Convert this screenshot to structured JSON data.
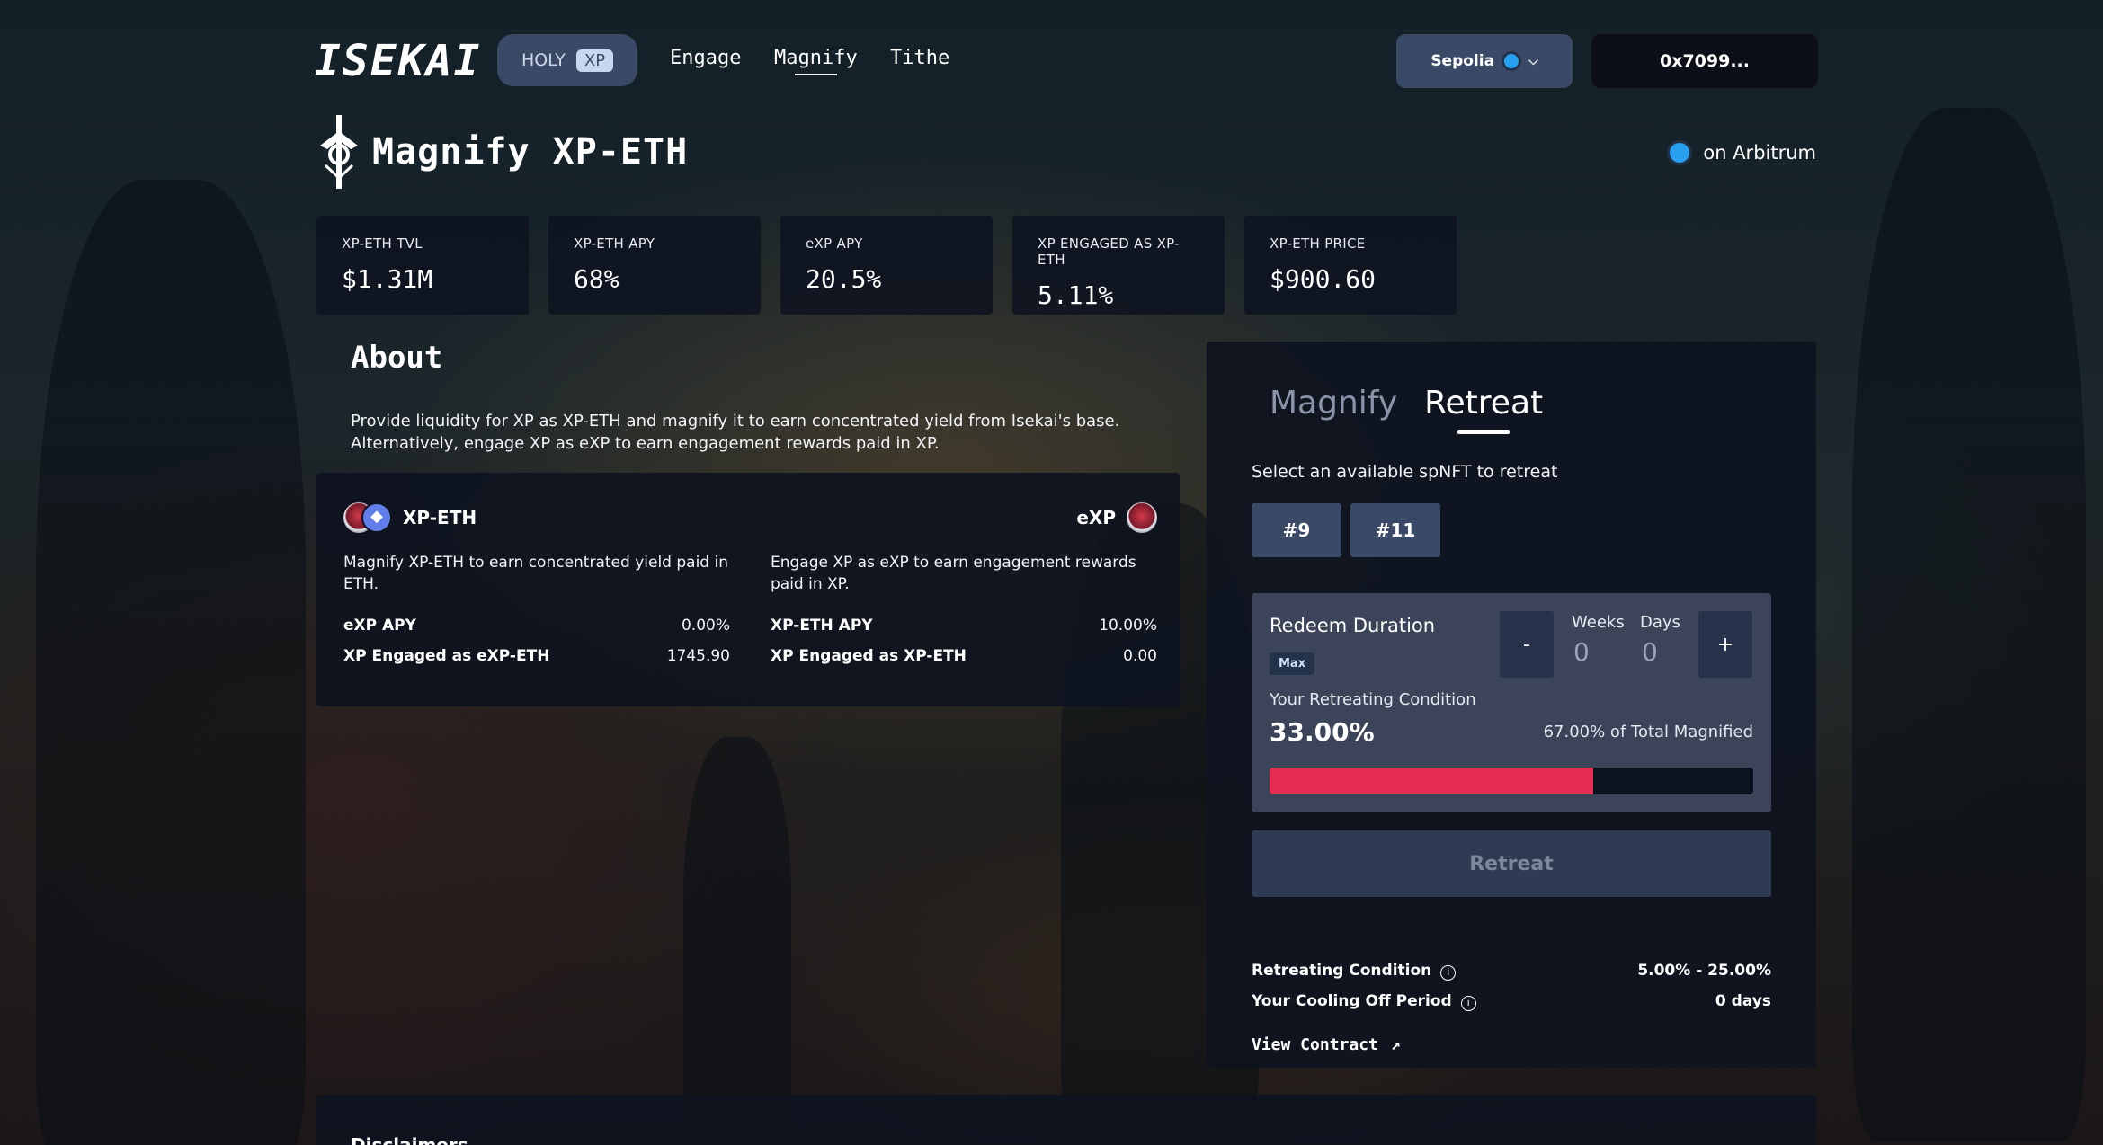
{
  "nav": {
    "logo": "ISEKAI",
    "holy_label": "HOLY",
    "holy_tag": "XP",
    "links": [
      "Engage",
      "Magnify",
      "Tithe"
    ],
    "network": "Sepolia",
    "wallet": "0x7099..."
  },
  "page": {
    "title": "Magnify XP-ETH",
    "chain": "on Arbitrum"
  },
  "stats": [
    {
      "label": "XP-ETH TVL",
      "value": "$1.31M"
    },
    {
      "label": "XP-ETH APY",
      "value": "68%"
    },
    {
      "label": "eXP APY",
      "value": "20.5%"
    },
    {
      "label": "XP ENGAGED AS XP-ETH",
      "value": "5.11%"
    },
    {
      "label": "XP-ETH PRICE",
      "value": "$900.60"
    }
  ],
  "about": {
    "title": "About",
    "line1": "Provide liquidity for XP as XP-ETH and magnify it to earn concentrated yield from Isekai's base.",
    "line2": "Alternatively, engage XP as eXP to earn engagement rewards paid in XP."
  },
  "pools": {
    "left": {
      "name": "XP-ETH",
      "desc": "Magnify XP-ETH to earn concentrated yield paid in ETH.",
      "row1_k": "eXP APY",
      "row1_v": "0.00%",
      "row2_k": "XP Engaged as eXP-ETH",
      "row2_v": "1745.90"
    },
    "right": {
      "name": "eXP",
      "desc": "Engage XP as eXP to earn engagement rewards paid in XP.",
      "row1_k": "XP-ETH APY",
      "row1_v": "10.00%",
      "row2_k": "XP Engaged as XP-ETH",
      "row2_v": "0.00"
    }
  },
  "panel": {
    "tabs": [
      "Magnify",
      "Retreat"
    ],
    "active_tab": "Retreat",
    "select_label": "Select an available spNFT to retreat",
    "nfts": [
      "#9",
      "#11"
    ],
    "redeem": {
      "title": "Redeem Duration",
      "max": "Max",
      "minus": "-",
      "plus": "+",
      "weeks_label": "Weeks",
      "weeks_value": "0",
      "days_label": "Days",
      "days_value": "0",
      "cond_label": "Your Retreating Condition",
      "cond_value": "33.00%",
      "cond_total": "67.00% of Total Magnified",
      "progress": 0.67
    },
    "retreat_button": "Retreat",
    "info": [
      {
        "label": "Retreating Condition",
        "value": "5.00% - 25.00%"
      },
      {
        "label": "Your Cooling Off Period",
        "value": "0 days"
      }
    ],
    "view_contract": "View Contract"
  },
  "disclaimer": {
    "title": "Disclaimers"
  },
  "colors": {
    "accent_red": "#e62e54",
    "button_blue": "#3a4a66",
    "card_bg": "#0e1320",
    "arbitrum": "#28a0f0"
  }
}
